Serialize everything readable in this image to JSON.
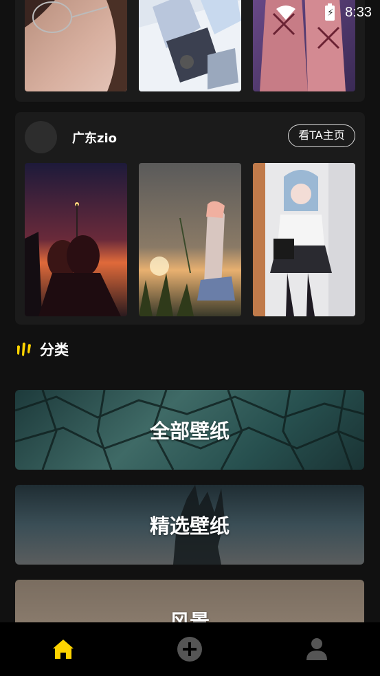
{
  "status_bar": {
    "time": "8:33",
    "icons": [
      "wifi-icon",
      "battery-charging-icon"
    ]
  },
  "top_card": {
    "thumbnails": [
      "girl-glasses-wallpaper",
      "anime-snow-wallpaper",
      "anime-kimono-wallpaper"
    ]
  },
  "user_card": {
    "username": "广东zio",
    "profile_button": "看TA主页",
    "thumbnails": [
      "sunset-couple-wallpaper",
      "girl-flower-sunset-wallpaper",
      "anime-schoolgirl-wallpaper"
    ]
  },
  "categories_section": {
    "title": "分类",
    "items": [
      {
        "label": "全部壁纸"
      },
      {
        "label": "精选壁纸"
      },
      {
        "label": "风景"
      }
    ]
  },
  "bottom_nav": {
    "items": [
      "home-icon",
      "add-icon",
      "profile-icon"
    ],
    "active_color": "#FFD400",
    "inactive_color": "#555555"
  },
  "colors": {
    "accent": "#FFD400",
    "background": "#111111",
    "card": "#1B1B1B"
  }
}
